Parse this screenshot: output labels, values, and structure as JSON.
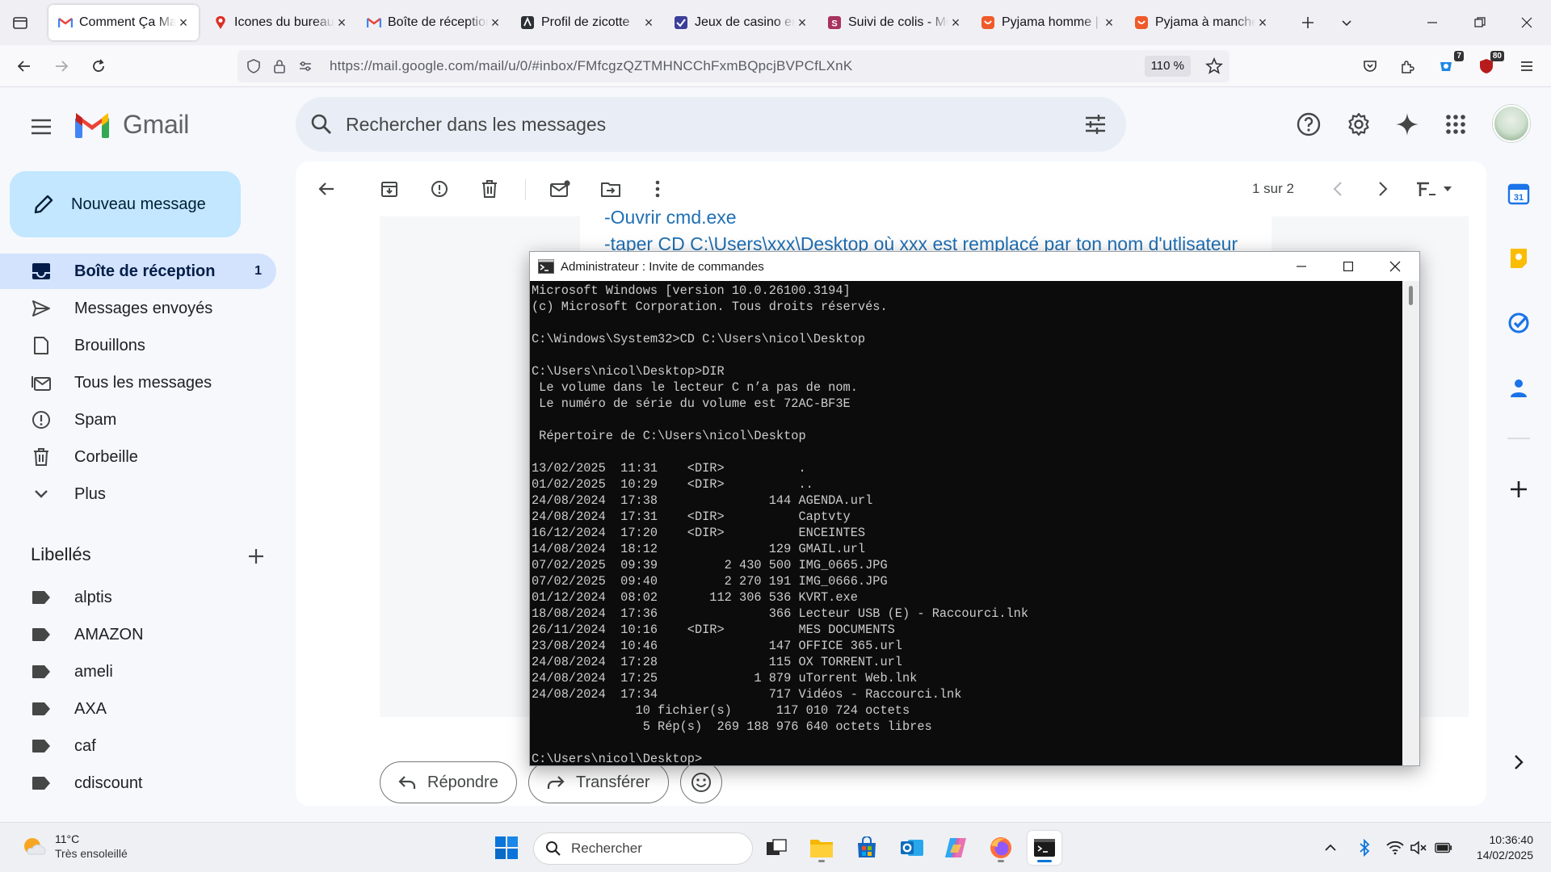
{
  "browser": {
    "tabs": [
      {
        "title": "Comment Ça Marche",
        "favicon": "gmail-icon",
        "active": true
      },
      {
        "title": "Icones du bureau",
        "favicon": "ccm-icon"
      },
      {
        "title": "Boîte de réception",
        "favicon": "gmail-icon"
      },
      {
        "title": "Profil de zicotte",
        "favicon": "profile-icon"
      },
      {
        "title": "Jeux de casino en",
        "favicon": "casino-icon"
      },
      {
        "title": "Suivi de colis - Mo",
        "favicon": "tracking-icon"
      },
      {
        "title": "Pyjama homme | A",
        "favicon": "shop-icon"
      },
      {
        "title": "Pyjama à manches",
        "favicon": "shop-icon"
      }
    ],
    "url": "https://mail.google.com/mail/u/0/#inbox/FMfcgzQZTMHNCChFxmBQpcjBVPCfLXnK",
    "zoom": "110 %",
    "badge_ext1": "7",
    "badge_ext2": "80"
  },
  "gmail": {
    "logo_text": "Gmail",
    "search_placeholder": "Rechercher dans les messages",
    "compose_label": "Nouveau message",
    "nav": [
      {
        "label": "Boîte de réception",
        "count": "1",
        "icon": "inbox-icon"
      },
      {
        "label": "Messages envoyés",
        "icon": "send-icon"
      },
      {
        "label": "Brouillons",
        "icon": "draft-icon"
      },
      {
        "label": "Tous les messages",
        "icon": "all-mail-icon"
      },
      {
        "label": "Spam",
        "icon": "spam-icon"
      },
      {
        "label": "Corbeille",
        "icon": "trash-icon"
      },
      {
        "label": "Plus",
        "icon": "chevron-down-icon"
      }
    ],
    "labels_heading": "Libellés",
    "labels": [
      "alptis",
      "AMAZON",
      "ameli",
      "AXA",
      "caf",
      "cdiscount"
    ],
    "pager": "1 sur 2",
    "message_lines": [
      "-Ouvrir cmd.exe",
      "-taper CD C:\\Users\\xxx\\Desktop où xxx est remplacé par ton nom d'utlisateur"
    ],
    "reply_label": "Répondre",
    "forward_label": "Transférer"
  },
  "cmd": {
    "title": "Administrateur : Invite de commandes",
    "lines": [
      "Microsoft Windows [version 10.0.26100.3194]",
      "(c) Microsoft Corporation. Tous droits réservés.",
      "",
      "C:\\Windows\\System32>CD C:\\Users\\nicol\\Desktop",
      "",
      "C:\\Users\\nicol\\Desktop>DIR",
      " Le volume dans le lecteur C n’a pas de nom.",
      " Le numéro de série du volume est 72AC-BF3E",
      "",
      " Répertoire de C:\\Users\\nicol\\Desktop",
      "",
      "13/02/2025  11:31    <DIR>          .",
      "01/02/2025  10:29    <DIR>          ..",
      "24/08/2024  17:38               144 AGENDA.url",
      "24/08/2024  17:31    <DIR>          Captvty",
      "16/12/2024  17:20    <DIR>          ENCEINTES",
      "14/08/2024  18:12               129 GMAIL.url",
      "07/02/2025  09:39         2 430 500 IMG_0665.JPG",
      "07/02/2025  09:40         2 270 191 IMG_0666.JPG",
      "01/12/2024  08:02       112 306 536 KVRT.exe",
      "18/08/2024  17:36               366 Lecteur USB (E) - Raccourci.lnk",
      "26/11/2024  10:16    <DIR>          MES DOCUMENTS",
      "23/08/2024  10:46               147 OFFICE 365.url",
      "24/08/2024  17:28               115 OX TORRENT.url",
      "24/08/2024  17:25             1 879 uTorrent Web.lnk",
      "24/08/2024  17:34               717 Vidéos - Raccourci.lnk",
      "              10 fichier(s)      117 010 724 octets",
      "               5 Rép(s)  269 188 976 640 octets libres",
      "",
      "C:\\Users\\nicol\\Desktop>"
    ]
  },
  "taskbar": {
    "temperature": "11°C",
    "condition": "Très ensoleillé",
    "search_placeholder": "Rechercher",
    "time": "10:36:40",
    "date": "14/02/2025"
  },
  "colors": {
    "gmail_bg": "#f6f8fc",
    "compose": "#c2e7ff",
    "active_nav": "#d3e3fd",
    "link_blue": "#1f6fb4",
    "cmd_bg": "#0c0c0c"
  }
}
